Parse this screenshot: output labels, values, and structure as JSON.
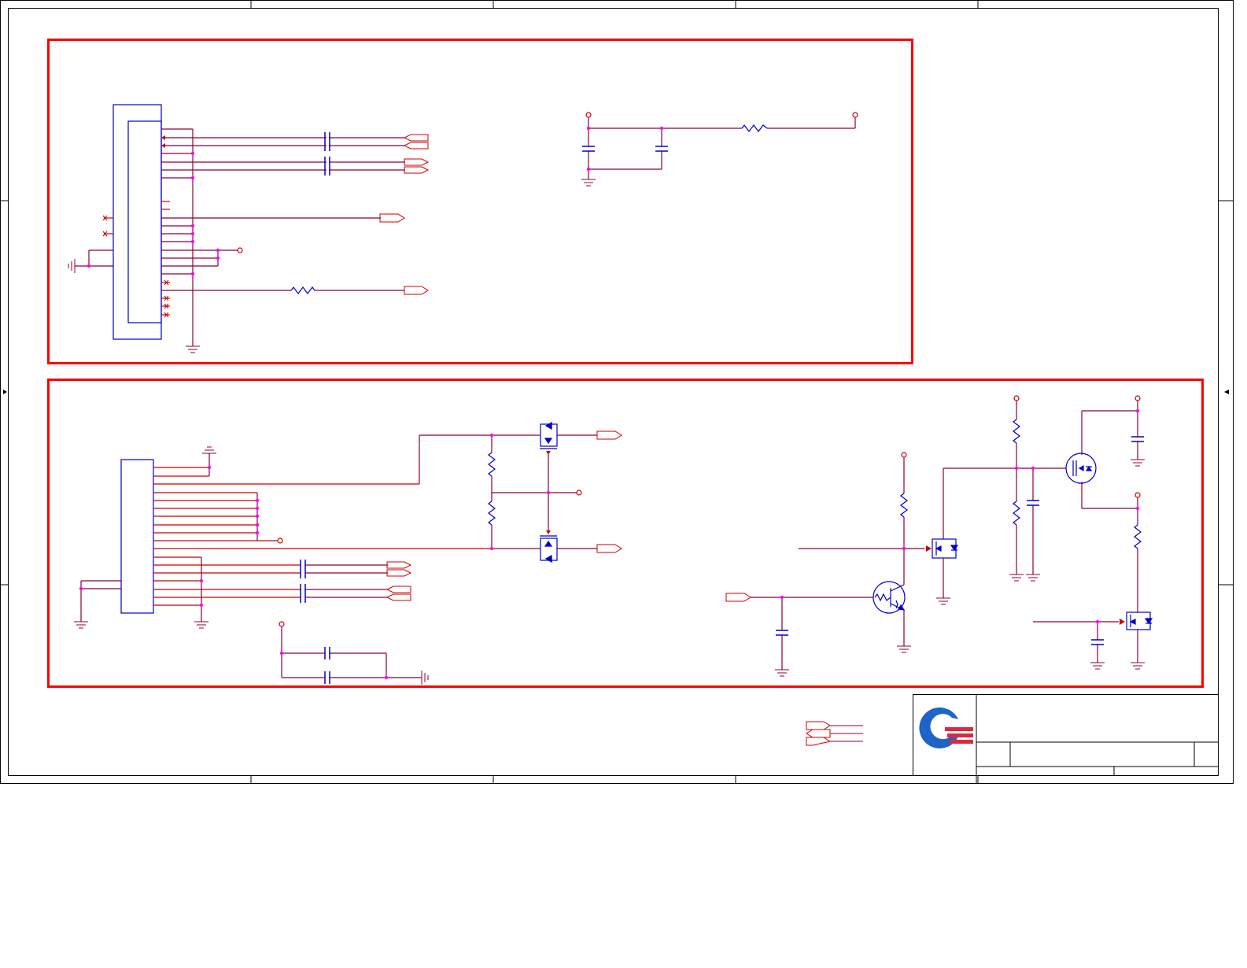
{
  "diagram": {
    "type": "electronic schematic sheet",
    "colors": {
      "frame": "#000000",
      "block_border": "#ff0000",
      "wire": "#8b0038",
      "pin": "#cc0000",
      "component": "#0000cc",
      "junction": "#ff00ff",
      "logo_blue": "#1e64c8",
      "logo_red": "#e0283c"
    },
    "title_block": {
      "logo": "quanta-logo"
    }
  }
}
